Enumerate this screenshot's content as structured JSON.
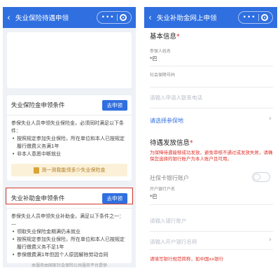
{
  "left": {
    "title": "失业保险待遇申领",
    "unemployment_insurance_card": {
      "title": "失业保险金申领条件",
      "button": "去申领",
      "intro": "参保失业人员申领失业保险金，必须同时满足以下条件：",
      "conditions": [
        "按照规定参加失业保险，所在单位和本人已按规定履行缴费义务满1年",
        "非本人意愿中断就业"
      ],
      "banner": "测一测我能领多少失业保险金"
    },
    "subsidy_card": {
      "title": "失业补助金申领条件",
      "button": "去申领",
      "intro": "参保失业人员申领失业补助金，满足以下条件之一：",
      "conditions": [
        "领取失业保险金期满仍未就业",
        "按照规定参加失业保险，所在单位和本人已按规定履行缴费义务不足1年",
        "参保缴费满1年但因个人原因解除劳动合同"
      ]
    },
    "footer": "本服务由国家社会保险公共服务平台提供"
  },
  "right": {
    "title": "失业补助金网上申领",
    "basic_info": {
      "heading": "基本信息",
      "required_mark": "*",
      "name_label": "参保人姓名",
      "name_value": "*巴",
      "ssn_label": "社会保障号码",
      "phone_placeholder": "请输入申请人联系电话",
      "location_link": "请选择参保地"
    },
    "payment_info": {
      "heading": "待遇发放信息",
      "required_mark": "*",
      "warning": "为保障待遇能够成功发放，避免审核不通过或发放失败，请确保您选择的银行账户为本人账户且可用。",
      "toggle_label": "社保卡银行账户",
      "toggle_on": false,
      "holder_label": "开户银行户名",
      "holder_value": "*巴",
      "account_placeholder": "请输入银行账户",
      "bank_placeholder": "请输入开户银行名称",
      "bank_warning": "请填写银行规范简称，如中国xx银行"
    }
  },
  "colors": {
    "primary": "#2f6fe0",
    "warning": "#e0332b",
    "highlight_border": "#d23a2e",
    "banner_bg": "#fbf1d8"
  },
  "icons": {
    "back": "chevron-left-icon",
    "more": "more-dots-icon",
    "close": "target-circle-icon",
    "forward": "chevron-right-icon"
  }
}
